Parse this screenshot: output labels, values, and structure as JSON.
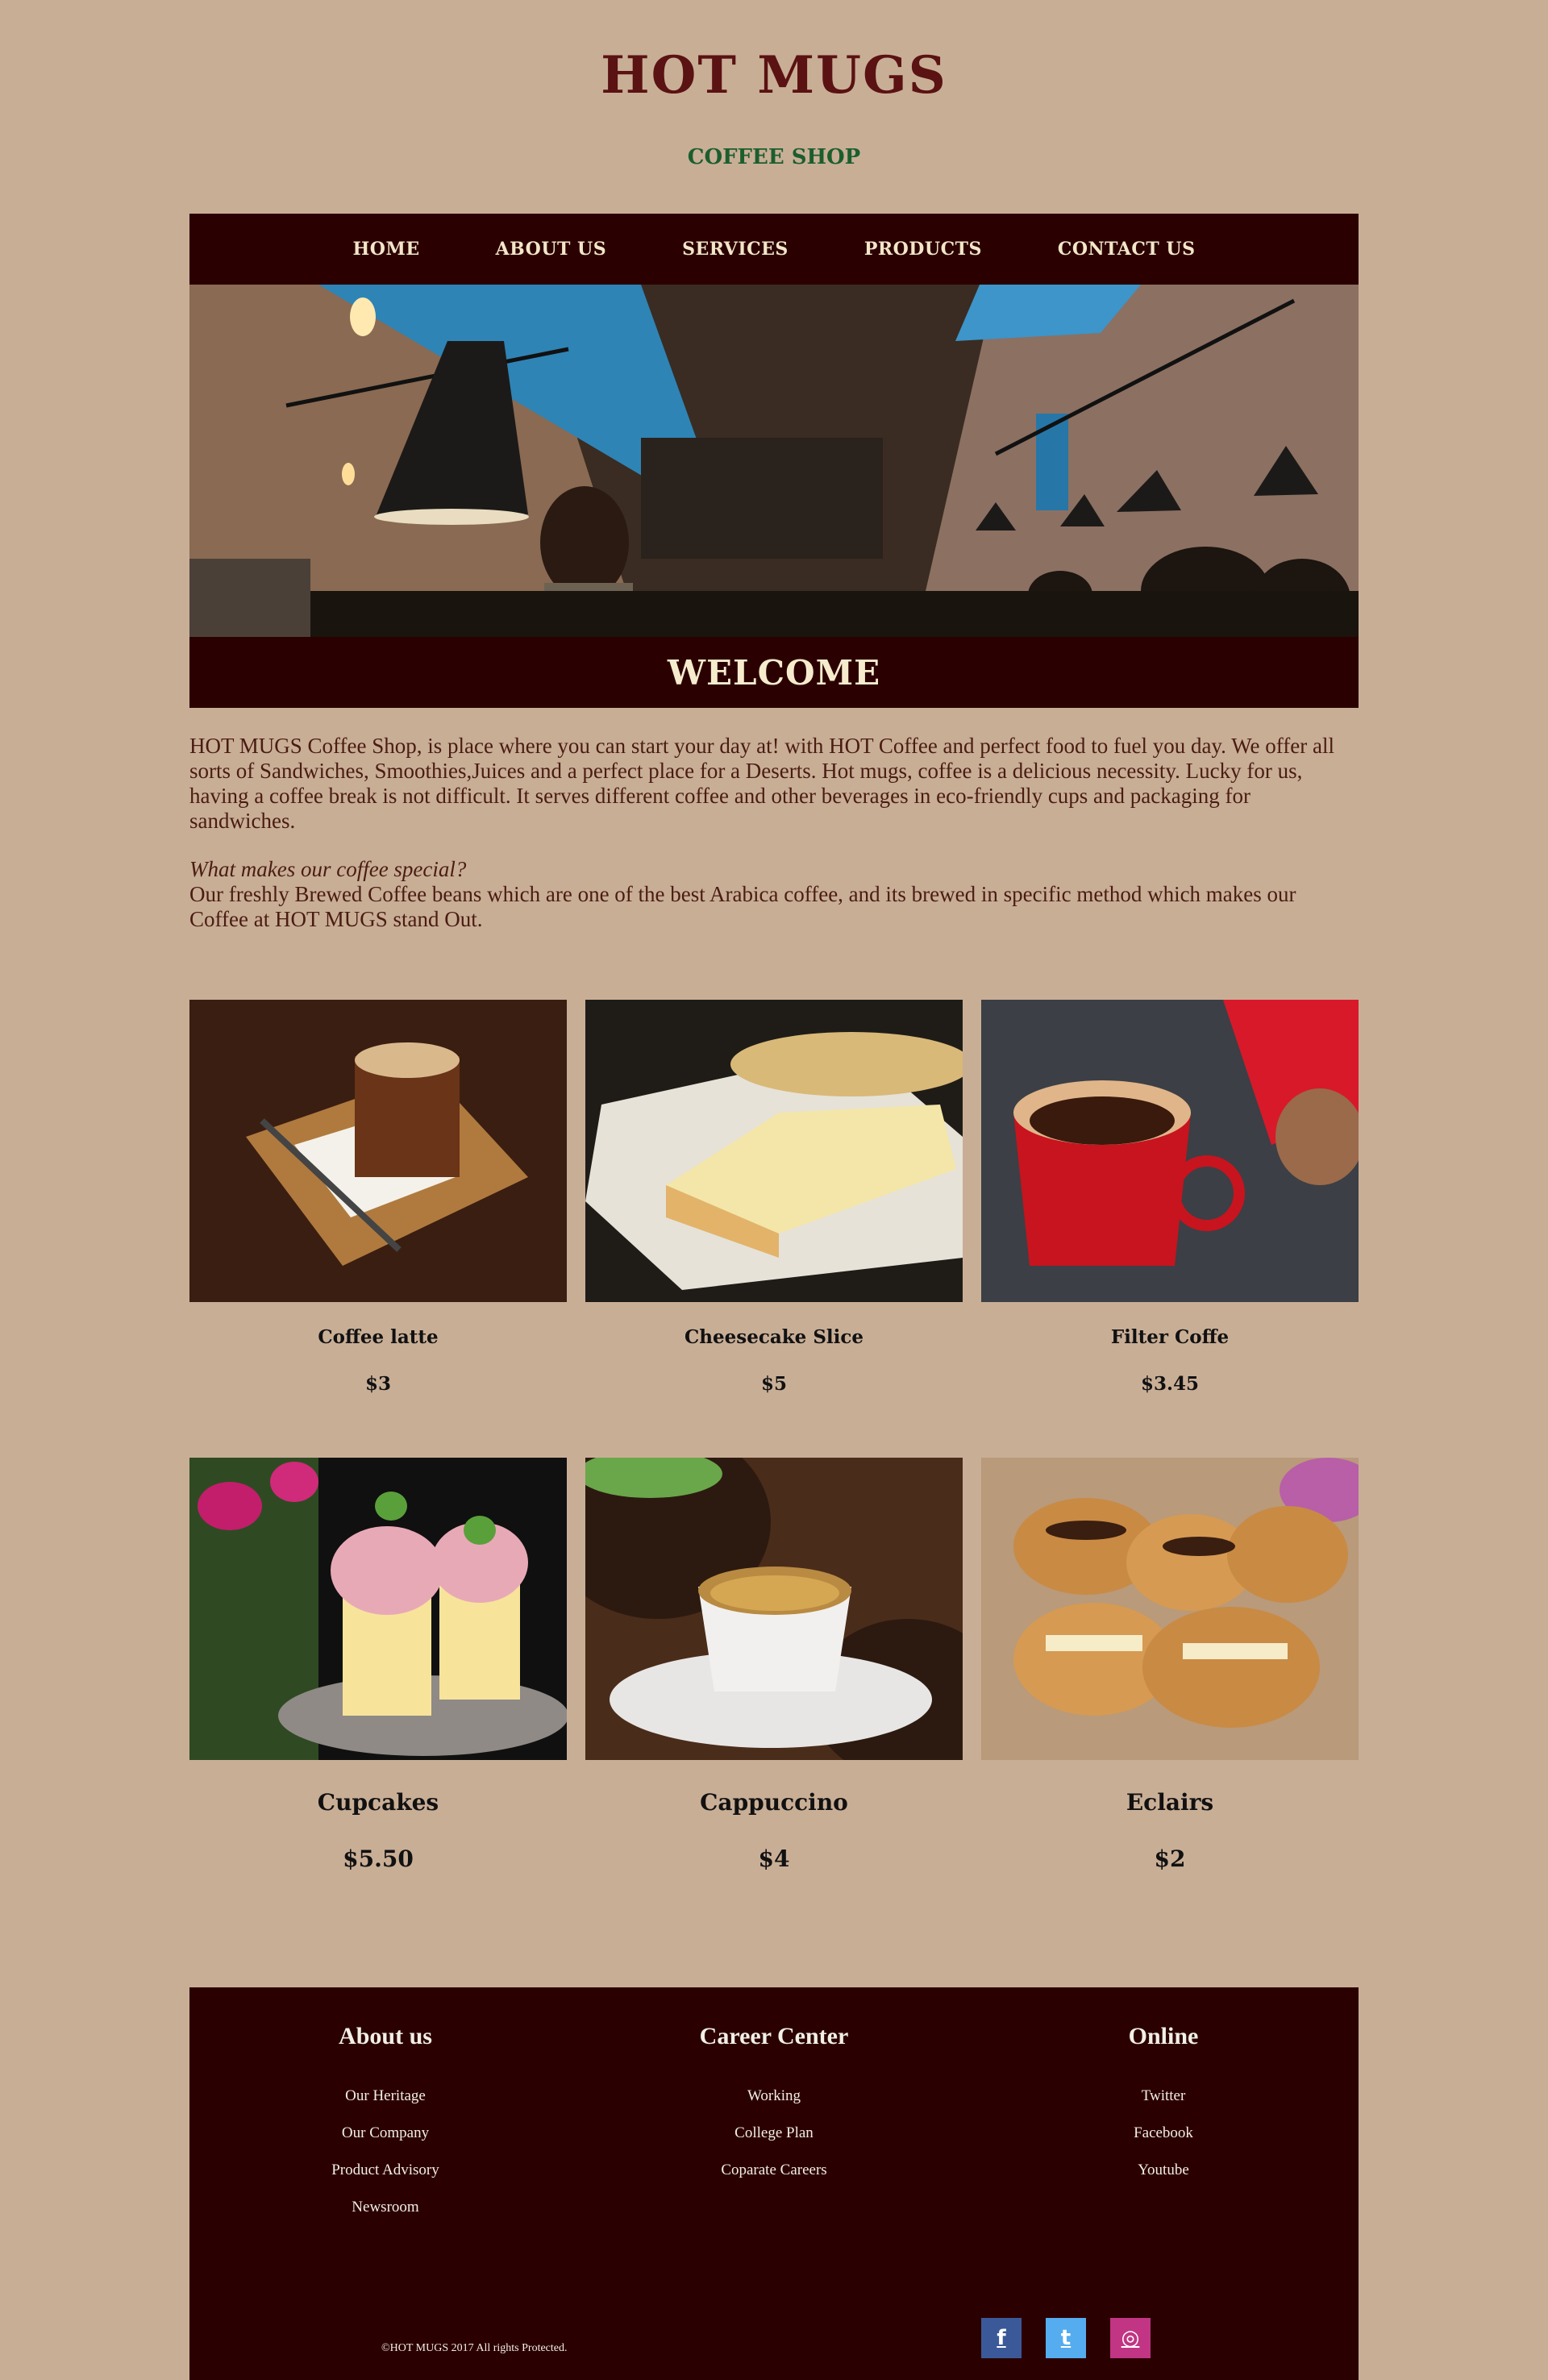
{
  "brand": {
    "title": "HOT MUGS",
    "subtitle": "COFFEE SHOP"
  },
  "nav": {
    "items": [
      "HOME",
      "ABOUT US",
      "SERVICES",
      "PRODUCTS",
      "CONTACT US"
    ]
  },
  "welcome": {
    "heading": "WELCOME",
    "intro": "HOT MUGS Coffee Shop, is place where you can start your day at! with HOT Coffee and perfect food to fuel you day. We offer all sorts of Sandwiches, Smoothies,Juices and a perfect place for a Deserts. Hot mugs, coffee is a delicious necessity. Lucky for us, having a coffee break is not difficult. It serves different coffee and other beverages in eco-friendly cups and packaging for sandwiches.",
    "question": "What makes our coffee special?",
    "answer": "Our freshly Brewed Coffee beans which are one of the best Arabica coffee, and its brewed in specific method which makes our Coffee at HOT MUGS stand Out."
  },
  "products": {
    "row1": [
      {
        "name": "Coffee latte",
        "price": "$3"
      },
      {
        "name": "Cheesecake Slice",
        "price": "$5"
      },
      {
        "name": "Filter Coffe",
        "price": "$3.45"
      }
    ],
    "row2": [
      {
        "name": "Cupcakes",
        "price": "$5.50"
      },
      {
        "name": "Cappuccino",
        "price": "$4"
      },
      {
        "name": "Eclairs",
        "price": "$2"
      }
    ]
  },
  "footer": {
    "columns": [
      {
        "title": "About us",
        "links": [
          "Our Heritage",
          "Our Company",
          "Product Advisory",
          "Newsroom"
        ]
      },
      {
        "title": "Career Center",
        "links": [
          "Working",
          "College Plan",
          "Coparate Careers"
        ]
      },
      {
        "title": "Online",
        "links": [
          "Twitter",
          "Facebook",
          "Youtube"
        ]
      }
    ],
    "copyright": "©HOT MUGS 2017 All rights Protected.",
    "social": [
      {
        "icon": "facebook-icon",
        "glyph": "f",
        "color": "#3b5998"
      },
      {
        "icon": "twitter-icon",
        "glyph": "t",
        "color": "#55acee"
      },
      {
        "icon": "instagram-icon",
        "glyph": "◎",
        "color": "#c13584"
      }
    ]
  },
  "colors": {
    "background": "#c9ae96",
    "dark": "#2b0000",
    "brand": "#5a1212",
    "subtitle": "#1b5e2e"
  }
}
